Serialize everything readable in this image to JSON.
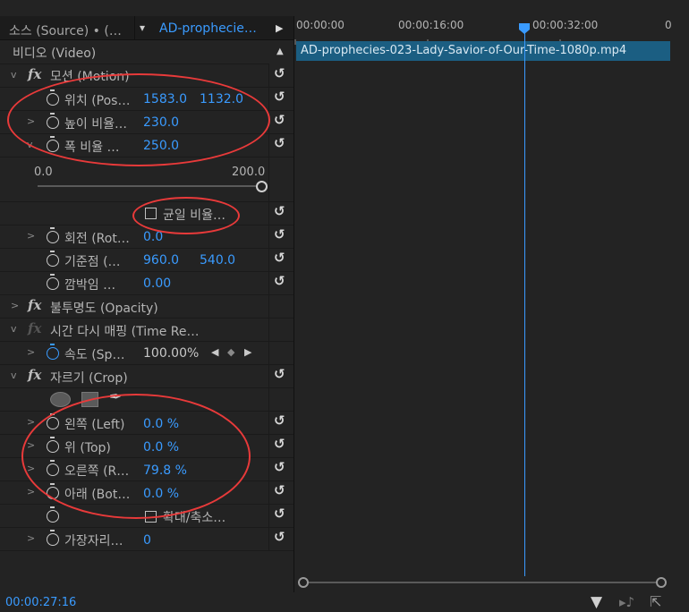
{
  "tabs": {
    "source_label": "소스 (Source) • (…",
    "active_label": "AD-prophecie…"
  },
  "effects": {
    "section_label": "비디오 (Video)",
    "motion": {
      "label": "모션 (Motion)",
      "position": {
        "label": "위치 (Pos…",
        "x": "1583.0",
        "y": "1132.0"
      },
      "scale_height": {
        "label": "높이 비율…",
        "value": "230.0"
      },
      "scale_width": {
        "label": "폭 비율 …",
        "value": "250.0"
      },
      "slider": {
        "min_label": "0.0",
        "max_label": "200.0",
        "level": 1.0
      },
      "uniform_scale": {
        "label": "균일 비율…",
        "checked": false
      },
      "rotation": {
        "label": "회전 (Rot…",
        "value": "0.0"
      },
      "anchor": {
        "label": "기준점 (…",
        "x": "960.0",
        "y": "540.0"
      },
      "flicker": {
        "label": "깜박임 …",
        "value": "0.00"
      }
    },
    "opacity": {
      "label": "불투명도 (Opacity)"
    },
    "time_remap": {
      "label": "시간 다시 매핑 (Time Re…",
      "speed": {
        "label": "속도 (Sp…",
        "value": "100.00%"
      }
    },
    "crop": {
      "label": "자르기 (Crop)",
      "left": {
        "label": "왼쪽 (Left)",
        "value": "0.0 %"
      },
      "top": {
        "label": "위 (Top)",
        "value": "0.0 %"
      },
      "right": {
        "label": "오른쪽 (R…",
        "value": "79.8 %"
      },
      "bottom": {
        "label": "아래 (Bot…",
        "value": "0.0 %"
      },
      "zoom": {
        "label": "확대/축소…",
        "checked": false
      },
      "feather": {
        "label": "가장자리…",
        "value": "0"
      }
    }
  },
  "timeline": {
    "ticks": [
      "00:00:00",
      "00:00:16:00",
      "00:00:32:00",
      "0"
    ],
    "clip_name": "AD-prophecies-023-Lady-Savior-of-Our-Time-1080p.mp4",
    "current_time": "00:00:27:16"
  },
  "icons": [
    "fx-icon",
    "stopwatch-icon",
    "reset-icon",
    "chevron-right-icon",
    "chevron-down-icon",
    "ellipse-mask-icon",
    "rectangle-mask-icon",
    "pen-mask-icon",
    "filter-icon",
    "insert-icon",
    "export-icon"
  ],
  "colors": {
    "accent": "#3a9bff",
    "clip": "#1b5e82",
    "annotation": "#e83a3a",
    "panel": "#232323"
  }
}
